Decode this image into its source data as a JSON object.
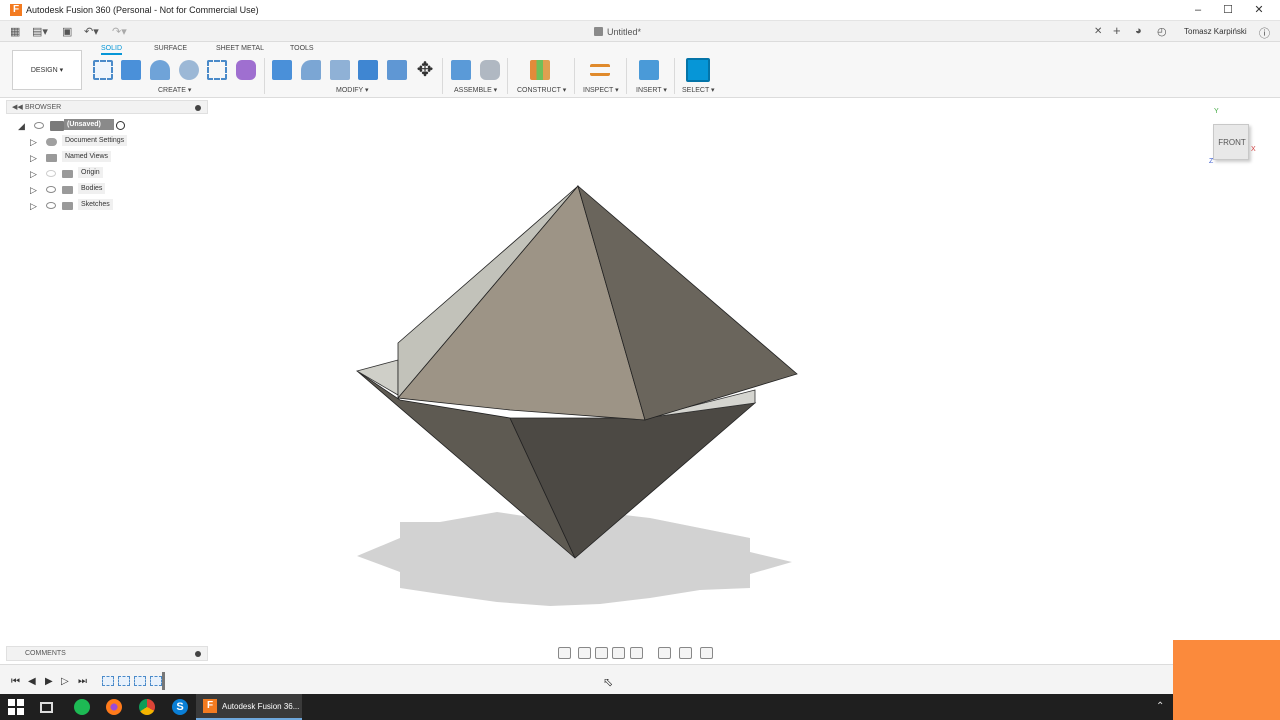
{
  "window": {
    "title": "Autodesk Fusion 360 (Personal - Not for Commercial Use)",
    "app_logo": "F",
    "controls": [
      "minimize-icon",
      "maximize-icon",
      "close-icon"
    ]
  },
  "document": {
    "title": "Untitled*",
    "user": "Tomasz Karpiński"
  },
  "toolbar": {
    "workspace_button": "DESIGN ▾",
    "tabs": [
      "SOLID",
      "SURFACE",
      "SHEET METAL",
      "TOOLS"
    ],
    "active_tab": "SOLID",
    "groups": [
      "CREATE ▾",
      "MODIFY ▾",
      "ASSEMBLE ▾",
      "CONSTRUCT ▾",
      "INSPECT ▾",
      "INSERT ▾",
      "SELECT ▾"
    ]
  },
  "browser": {
    "header": "BROWSER",
    "root": "(Unsaved)",
    "items": [
      {
        "label": "Document Settings",
        "icon": "gear-icon"
      },
      {
        "label": "Named Views",
        "icon": "folder-icon"
      },
      {
        "label": "Origin",
        "icon": "folder-icon"
      },
      {
        "label": "Bodies",
        "icon": "folder-icon"
      },
      {
        "label": "Sketches",
        "icon": "folder-icon"
      }
    ]
  },
  "comments": {
    "header": "COMMENTS"
  },
  "viewcube": {
    "face": "FRONT",
    "x": "X",
    "y": "Y",
    "z": "Z"
  },
  "taskbar": {
    "active_app": "Autodesk Fusion 36...",
    "icons": [
      "windows-start-icon",
      "task-view-icon",
      "spotify-icon",
      "firefox-icon",
      "chrome-icon",
      "skype-icon"
    ]
  },
  "colors": {
    "accent": "#0696d7",
    "fusion_orange": "#f37b20",
    "overlay_orange": "#fb8a3c"
  }
}
